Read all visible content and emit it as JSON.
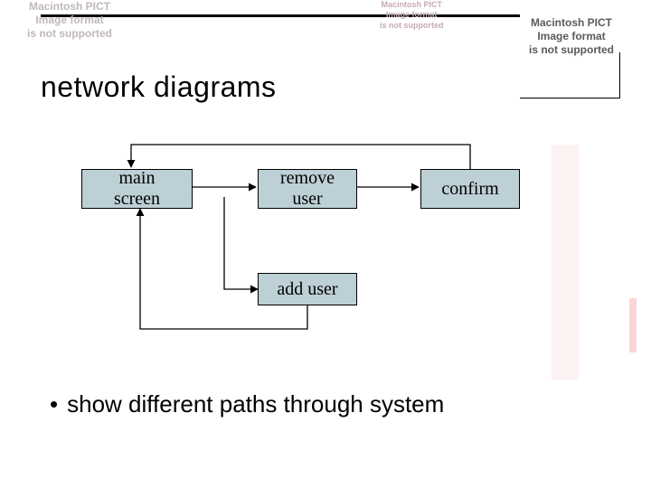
{
  "title": "network diagrams",
  "errors": {
    "pict": "Macintosh PICT\nImage format\nis not supported"
  },
  "nodes": {
    "main": "main\nscreen",
    "remove": "remove\nuser",
    "confirm": "confirm",
    "add": "add user"
  },
  "bullet": "show different paths through system"
}
